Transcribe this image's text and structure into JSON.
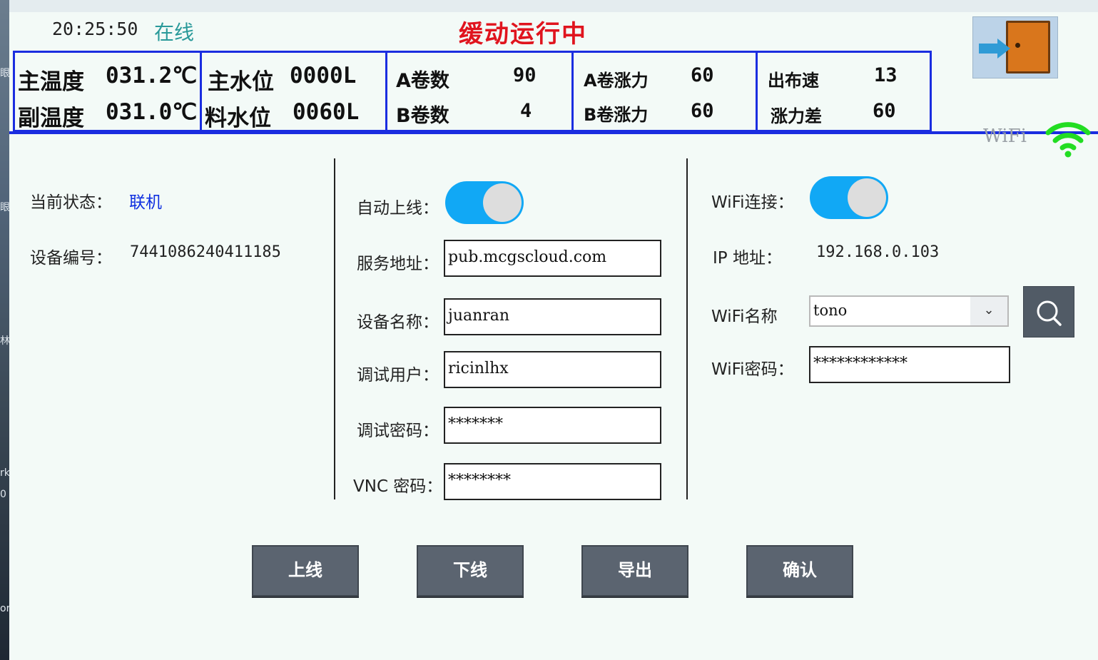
{
  "header": {
    "time": "20:25:50",
    "online_status": "在线",
    "run_state": "缓动运行中"
  },
  "metrics": {
    "main_temp_label": "主温度",
    "main_temp_value": "031.2℃",
    "sub_temp_label": "副温度",
    "sub_temp_value": "031.0℃",
    "main_water_label": "主水位",
    "main_water_value": "0000L",
    "feed_water_label": "料水位",
    "feed_water_value": "0060L",
    "a_rolls_label": "A卷数",
    "a_rolls_value": "90",
    "b_rolls_label": "B卷数",
    "b_rolls_value": "4",
    "a_tension_label": "A卷涨力",
    "a_tension_value": "60",
    "b_tension_label": "B卷涨力",
    "b_tension_value": "60",
    "output_speed_label": "出布速",
    "output_speed_value": "13",
    "tension_diff_label": "涨力差",
    "tension_diff_value": "60"
  },
  "wifi_indicator": {
    "label": "WiFi",
    "color": "#22dd22"
  },
  "device": {
    "status_label": "当前状态：",
    "status_value": "联机",
    "serial_label": "设备编号：",
    "serial_value": "7441086240411185"
  },
  "cloud": {
    "auto_online_label": "自动上线：",
    "auto_online_on": true,
    "server_label": "服务地址：",
    "server_value": "pub.mcgscloud.com",
    "device_name_label": "设备名称：",
    "device_name_value": "juanran",
    "debug_user_label": "调试用户：",
    "debug_user_value": "ricinlhx",
    "debug_pass_label": "调试密码：",
    "debug_pass_value": "*******",
    "vnc_pass_label": "VNC 密码：",
    "vnc_pass_value": "********"
  },
  "wifi": {
    "connect_label": "WiFi连接：",
    "connect_on": true,
    "ip_label": "IP  地址：",
    "ip_value": "192.168.0.103",
    "name_label": "WiFi名称",
    "name_value": "tono",
    "pass_label": "WiFi密码：",
    "pass_value": "************"
  },
  "buttons": {
    "online": "上线",
    "offline": "下线",
    "export": "导出",
    "confirm": "确认"
  },
  "colors": {
    "accent_blue": "#1a2de0",
    "toggle_on": "#11a8f5",
    "alert_red": "#e0141e",
    "online_teal": "#2a9a9a"
  }
}
